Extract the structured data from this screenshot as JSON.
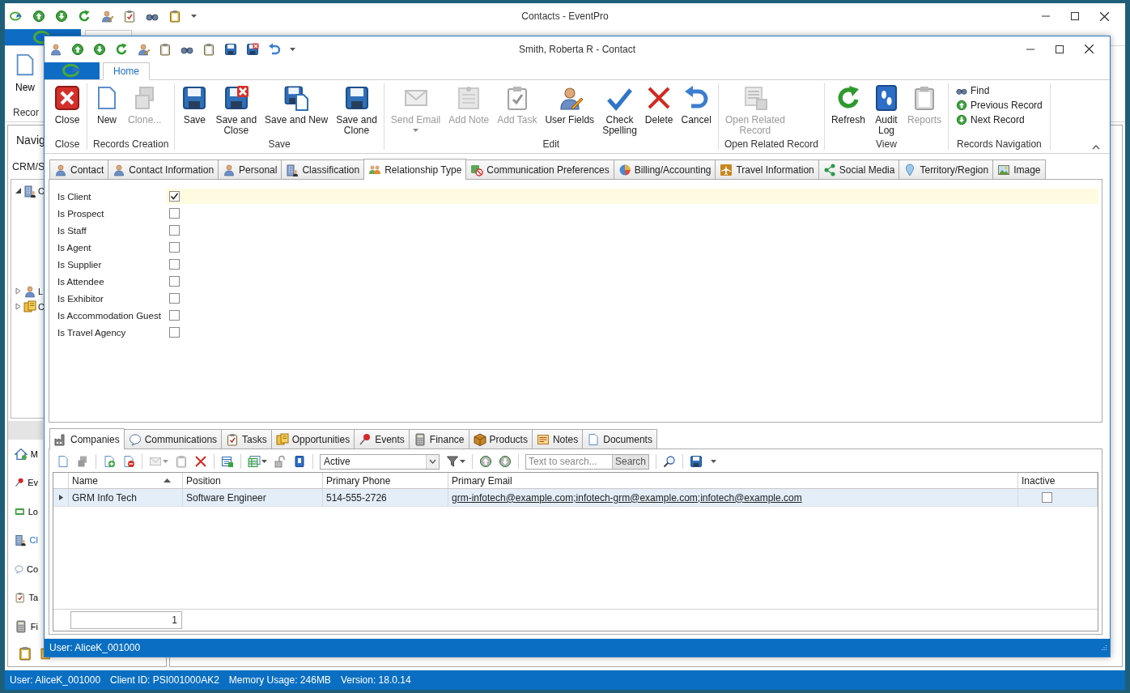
{
  "app_window": {
    "title": "Contacts - EventPro",
    "ribbon": {
      "new_button": "New",
      "group_label": "Recor"
    },
    "navigation": {
      "header": "Navig",
      "subheader": "CRM/S",
      "tree": [
        {
          "label": "C",
          "expanded": true
        },
        {
          "label": "L",
          "expanded": false
        },
        {
          "label": "C",
          "expanded": false
        }
      ],
      "items": [
        {
          "label": "M",
          "kind": "home",
          "selected": false
        },
        {
          "label": "Ev",
          "kind": "pin",
          "selected": false
        },
        {
          "label": "Lo",
          "kind": "bed",
          "selected": false
        },
        {
          "label": "Cl",
          "kind": "building",
          "selected": true
        },
        {
          "label": "Co",
          "kind": "bubble",
          "selected": false
        },
        {
          "label": "Ta",
          "kind": "task",
          "selected": false
        },
        {
          "label": "Fi",
          "kind": "calc",
          "selected": false
        }
      ]
    },
    "status_bar": [
      "User: AliceK_001000",
      "Client ID: PSI001000AK2",
      "Memory Usage: 246MB",
      "Version: 18.0.14"
    ]
  },
  "dialog": {
    "title": "Smith, Roberta R - Contact",
    "ribbon_tabs": [
      {
        "label": "Home",
        "selected": true
      }
    ],
    "ribbon_groups": [
      {
        "label": "Close",
        "kind": "large",
        "buttons": [
          {
            "label": "Close",
            "kind": "close",
            "disabled": false,
            "dropdown": false
          }
        ]
      },
      {
        "label": "Records Creation",
        "kind": "large",
        "buttons": [
          {
            "label": "New",
            "kind": "new",
            "disabled": false,
            "dropdown": false
          },
          {
            "label": "Clone...",
            "kind": "clone",
            "disabled": true,
            "dropdown": false
          }
        ]
      },
      {
        "label": "Save",
        "kind": "large",
        "buttons": [
          {
            "label": "Save",
            "kind": "save",
            "disabled": false,
            "dropdown": false
          },
          {
            "label": "Save and\nClose",
            "kind": "saveclose",
            "disabled": false,
            "dropdown": false
          },
          {
            "label": "Save and New",
            "kind": "savenew",
            "disabled": false,
            "dropdown": false
          },
          {
            "label": "Save and\nClone",
            "kind": "save",
            "disabled": false,
            "dropdown": false
          }
        ]
      },
      {
        "label": "Edit",
        "kind": "large",
        "buttons": [
          {
            "label": "Send Email",
            "kind": "email",
            "disabled": true,
            "dropdown": true
          },
          {
            "label": "Add Note",
            "kind": "note",
            "disabled": true,
            "dropdown": false
          },
          {
            "label": "Add Task",
            "kind": "task",
            "disabled": true,
            "dropdown": false
          },
          {
            "label": "User Fields",
            "kind": "user",
            "disabled": false,
            "dropdown": false
          },
          {
            "label": "Check\nSpelling",
            "kind": "spell",
            "disabled": false,
            "dropdown": false
          },
          {
            "label": "Delete",
            "kind": "delete",
            "disabled": false,
            "dropdown": false
          },
          {
            "label": "Cancel",
            "kind": "undo",
            "disabled": false,
            "dropdown": false
          }
        ]
      },
      {
        "label": "Open Related Record",
        "kind": "large",
        "buttons": [
          {
            "label": "Open Related\nRecord",
            "kind": "related",
            "disabled": true,
            "dropdown": false
          }
        ]
      },
      {
        "label": "View",
        "kind": "large",
        "buttons": [
          {
            "label": "Refresh",
            "kind": "refresh",
            "disabled": false,
            "dropdown": false
          },
          {
            "label": "Audit\nLog",
            "kind": "audit",
            "disabled": false,
            "dropdown": false
          },
          {
            "label": "Reports",
            "kind": "reports",
            "disabled": true,
            "dropdown": false
          }
        ]
      },
      {
        "label": "Records Navigation",
        "kind": "small",
        "buttons": [
          {
            "label": "Find",
            "kind": "find",
            "disabled": false,
            "dropdown": false
          },
          {
            "label": "Previous Record",
            "kind": "up",
            "disabled": false,
            "dropdown": false
          },
          {
            "label": "Next Record",
            "kind": "down",
            "disabled": false,
            "dropdown": false
          }
        ]
      }
    ],
    "tabs": [
      {
        "label": "Contact",
        "kind": "person",
        "selected": false
      },
      {
        "label": "Contact Information",
        "kind": "person",
        "selected": false
      },
      {
        "label": "Personal",
        "kind": "person",
        "selected": false
      },
      {
        "label": "Classification",
        "kind": "building",
        "selected": false
      },
      {
        "label": "Relationship Type",
        "kind": "group",
        "selected": true
      },
      {
        "label": "Communication Preferences",
        "kind": "ban",
        "selected": false
      },
      {
        "label": "Billing/Accounting",
        "kind": "pie",
        "selected": false
      },
      {
        "label": "Travel Information",
        "kind": "plane",
        "selected": false
      },
      {
        "label": "Social Media",
        "kind": "share",
        "selected": false
      },
      {
        "label": "Territory/Region",
        "kind": "pin2",
        "selected": false
      },
      {
        "label": "Image",
        "kind": "image",
        "selected": false
      }
    ],
    "fields": [
      {
        "label": "Is Client",
        "checked": true,
        "selected": true
      },
      {
        "label": "Is Prospect",
        "checked": false,
        "selected": false
      },
      {
        "label": "Is Staff",
        "checked": false,
        "selected": false
      },
      {
        "label": "Is Agent",
        "checked": false,
        "selected": false
      },
      {
        "label": "Is Supplier",
        "checked": false,
        "selected": false
      },
      {
        "label": "Is Attendee",
        "checked": false,
        "selected": false
      },
      {
        "label": "Is Exhibitor",
        "checked": false,
        "selected": false
      },
      {
        "label": "Is Accommodation Guest",
        "checked": false,
        "selected": false
      },
      {
        "label": "Is Travel Agency",
        "checked": false,
        "selected": false
      }
    ],
    "detail_tabs": [
      {
        "label": "Companies",
        "kind": "factory",
        "selected": true
      },
      {
        "label": "Communications",
        "kind": "bubble",
        "selected": false
      },
      {
        "label": "Tasks",
        "kind": "task",
        "selected": false
      },
      {
        "label": "Opportunities",
        "kind": "opps",
        "selected": false
      },
      {
        "label": "Events",
        "kind": "pin",
        "selected": false
      },
      {
        "label": "Finance",
        "kind": "calc",
        "selected": false
      },
      {
        "label": "Products",
        "kind": "box",
        "selected": false
      },
      {
        "label": "Notes",
        "kind": "memo",
        "selected": false
      },
      {
        "label": "Documents",
        "kind": "doc",
        "selected": false
      }
    ],
    "grid_toolbar": {
      "status_filter": "Active",
      "search_placeholder": "Text to search...",
      "search_button": "Search"
    },
    "grid": {
      "columns": [
        {
          "label": "Name",
          "sorted": true
        },
        {
          "label": "Position",
          "sorted": false
        },
        {
          "label": "Primary Phone",
          "sorted": false
        },
        {
          "label": "Primary Email",
          "sorted": false
        },
        {
          "label": "Inactive",
          "sorted": false
        }
      ],
      "rows": [
        {
          "name": "GRM Info Tech",
          "position": "Software Engineer",
          "primary_phone": "514-555-2726",
          "primary_email": "grm-infotech@example.com;infotech-grm@example.com;infotech@example.com",
          "inactive": false,
          "selected": true
        }
      ],
      "row_count": "1"
    },
    "status_bar": "User: AliceK_001000"
  }
}
